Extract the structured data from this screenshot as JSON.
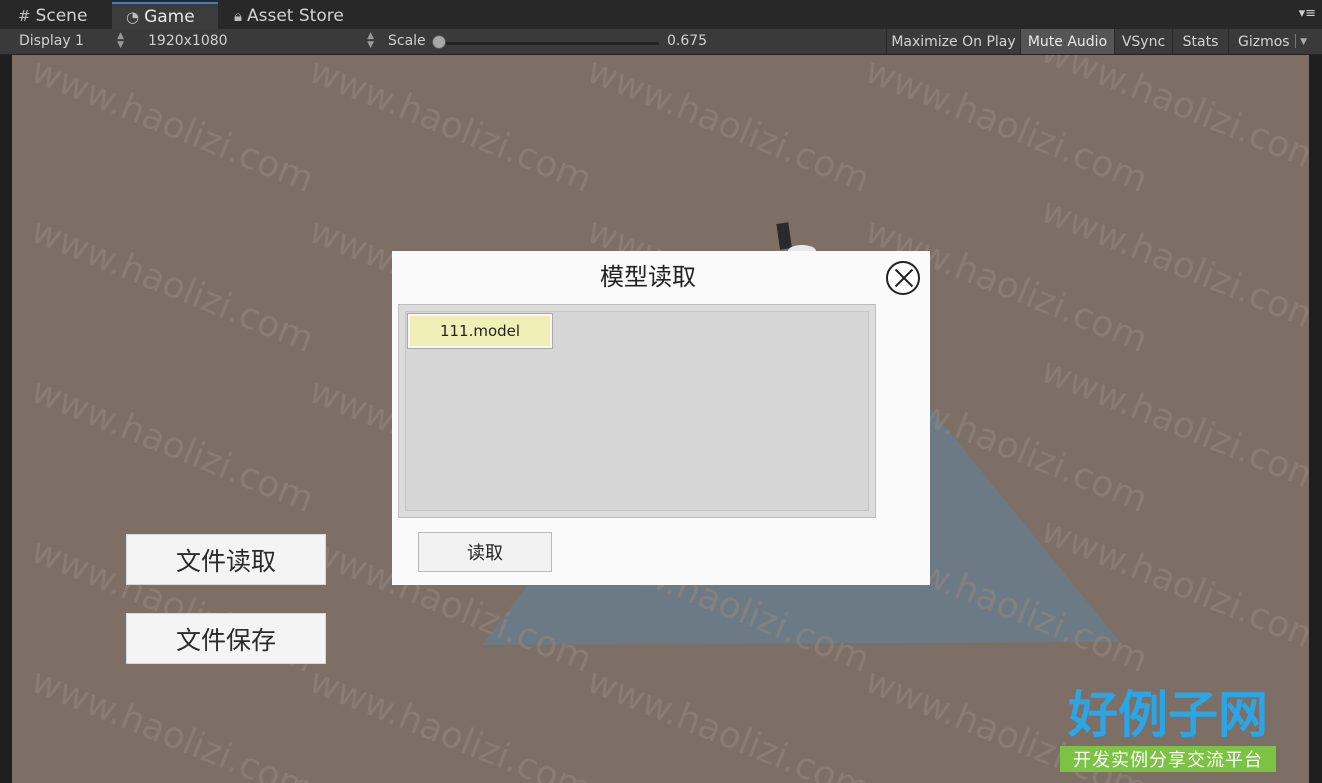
{
  "tabs": [
    {
      "label": "Scene",
      "icon": "grid-icon"
    },
    {
      "label": "Game",
      "icon": "pacman-icon"
    },
    {
      "label": "Asset Store",
      "icon": "lock-icon"
    }
  ],
  "toolbar": {
    "display": "Display 1",
    "resolution": "1920x1080",
    "scale_label": "Scale",
    "scale_value": "0.675",
    "maximize": "Maximize On Play",
    "mute": "Mute Audio",
    "vsync": "VSync",
    "stats": "Stats",
    "gizmos": "Gizmos"
  },
  "watermark": "www.haolizi.com",
  "game": {
    "read_file_button": "文件读取",
    "save_file_button": "文件保存"
  },
  "dialog": {
    "title": "模型读取",
    "files": [
      "111.model"
    ],
    "read_button": "读取"
  },
  "logo": {
    "main": "好例子网",
    "sub": "开发实例分享交流平台"
  },
  "colors": {
    "accent": "#3d7ecb",
    "viewport": "#7d6f66",
    "plane": "#6c7a85",
    "selected_item": "#f0efb6",
    "logo_blue": "#2aa5e6",
    "logo_green": "#7cc243"
  }
}
